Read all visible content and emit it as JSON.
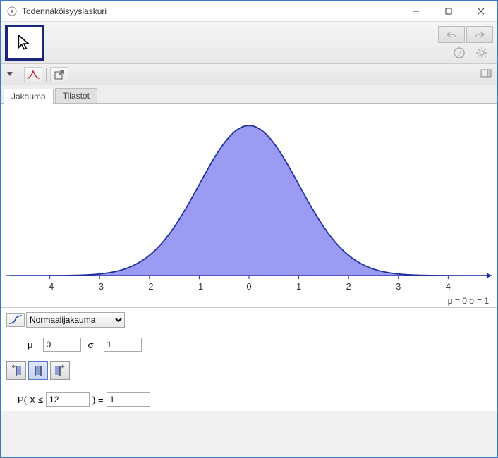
{
  "window": {
    "title": "Todennäköisyyslaskuri"
  },
  "tabs": [
    {
      "label": "Jakauma"
    },
    {
      "label": "Tilastot"
    }
  ],
  "distribution": {
    "selected": "Normaalijakauma"
  },
  "params": {
    "mu_label": "μ",
    "mu_value": "0",
    "sigma_label": "σ",
    "sigma_value": "1"
  },
  "probability": {
    "prefix": "P( X ≤",
    "x_value": "12",
    "mid": ") =",
    "result": "1"
  },
  "axis_info": "μ = 0   σ = 1",
  "chart_data": {
    "type": "area",
    "title": "",
    "xlabel": "",
    "ylabel": "",
    "x_ticks": [
      -4,
      -3,
      -2,
      -1,
      0,
      1,
      2,
      3,
      4
    ],
    "x_range": [
      -4.8,
      4.8
    ],
    "series": [
      {
        "name": "Normal PDF μ=0 σ=1",
        "x": [
          -4.0,
          -3.5,
          -3.0,
          -2.5,
          -2.0,
          -1.5,
          -1.0,
          -0.5,
          0.0,
          0.5,
          1.0,
          1.5,
          2.0,
          2.5,
          3.0,
          3.5,
          4.0
        ],
        "y": [
          0.0001,
          0.0009,
          0.0044,
          0.0175,
          0.054,
          0.1295,
          0.242,
          0.3521,
          0.3989,
          0.3521,
          0.242,
          0.1295,
          0.054,
          0.0175,
          0.0044,
          0.0009,
          0.0001
        ]
      }
    ],
    "ylim": [
      0,
      0.42
    ],
    "shaded_upto_x": 12
  }
}
